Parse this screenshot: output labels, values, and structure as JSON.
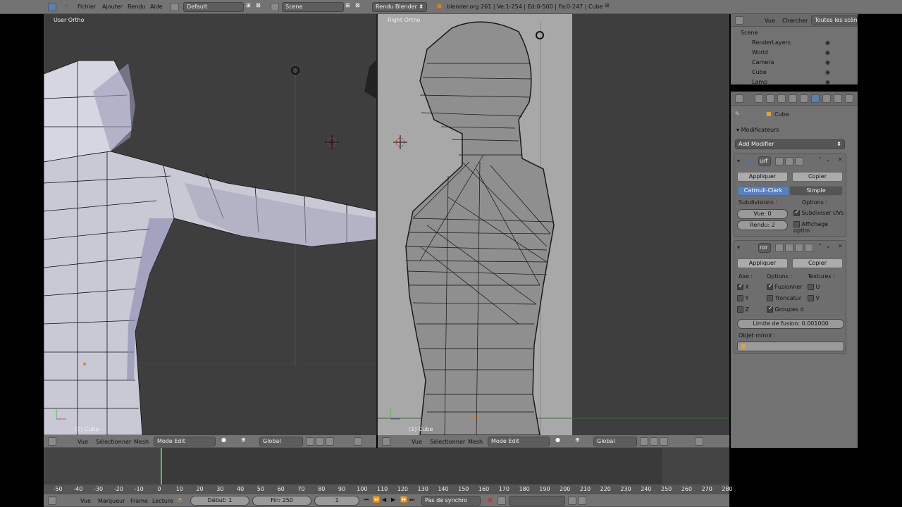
{
  "topbar": {
    "menus": [
      "Fichier",
      "Ajouter",
      "Rendu",
      "Aide"
    ],
    "layout": "Default",
    "scene": "Scene",
    "engine": "Rendu Blender",
    "stats": "blender.org 261 | Ve:1-254 | Ed:0-500 | Fa:0-247 | Cube"
  },
  "viewport_left": {
    "label": "User Ortho",
    "object_label": "(1) Cube"
  },
  "viewport_right": {
    "label": "Right Ortho",
    "object_label": "(1) Cube"
  },
  "view3d_header": {
    "menus": [
      "Vue",
      "Sélectionner",
      "Mesh"
    ],
    "mode": "Mode Edit",
    "orientation": "Global"
  },
  "outliner": {
    "menus": [
      "Vue",
      "Chercher"
    ],
    "filter": "Toutes les scènes",
    "items": [
      {
        "label": "Scene",
        "indent": 0
      },
      {
        "label": "RenderLayers",
        "indent": 1
      },
      {
        "label": "World",
        "indent": 1
      },
      {
        "label": "Camera",
        "indent": 1
      },
      {
        "label": "Cube",
        "indent": 1
      },
      {
        "label": "Lamp",
        "indent": 1
      }
    ]
  },
  "properties": {
    "context_object": "Cube",
    "panel_title": "Modificateurs",
    "add_modifier": "Add Modifier",
    "mod1": {
      "name": "urf",
      "apply": "Appliquer",
      "copy": "Copier",
      "type_a": "Catmull-Clark",
      "type_b": "Simple",
      "subdiv_label": "Subdivisions :",
      "options_label": "Options :",
      "view": "Vue: 0",
      "render": "Rendu: 2",
      "opt1": "Subdiviser UVs",
      "opt2": "Affichage optim"
    },
    "mod2": {
      "name": "ror",
      "apply": "Appliquer",
      "copy": "Copier",
      "axis_label": "Axe :",
      "options_label": "Options :",
      "textures_label": "Textures :",
      "x": "X",
      "y": "Y",
      "z": "Z",
      "merge": "Fusionner",
      "clip": "Troncatur",
      "vgroups": "Groupes d",
      "u": "U",
      "v": "V",
      "merge_limit": "Limite de fusion: 0.001000",
      "mirror_object": "Objet miroir :"
    }
  },
  "timeline": {
    "ticks": [
      "-50",
      "-40",
      "-30",
      "-20",
      "-10",
      "0",
      "10",
      "20",
      "30",
      "40",
      "50",
      "60",
      "70",
      "80",
      "90",
      "100",
      "110",
      "120",
      "130",
      "140",
      "150",
      "160",
      "170",
      "180",
      "190",
      "200",
      "210",
      "220",
      "230",
      "240",
      "250",
      "260",
      "270",
      "280"
    ],
    "menus": [
      "Vue",
      "Marqueur",
      "Frame",
      "Lecture"
    ],
    "start": "Début: 1",
    "end": "Fin: 250",
    "current": "1",
    "sync": "Pas de synchro"
  }
}
